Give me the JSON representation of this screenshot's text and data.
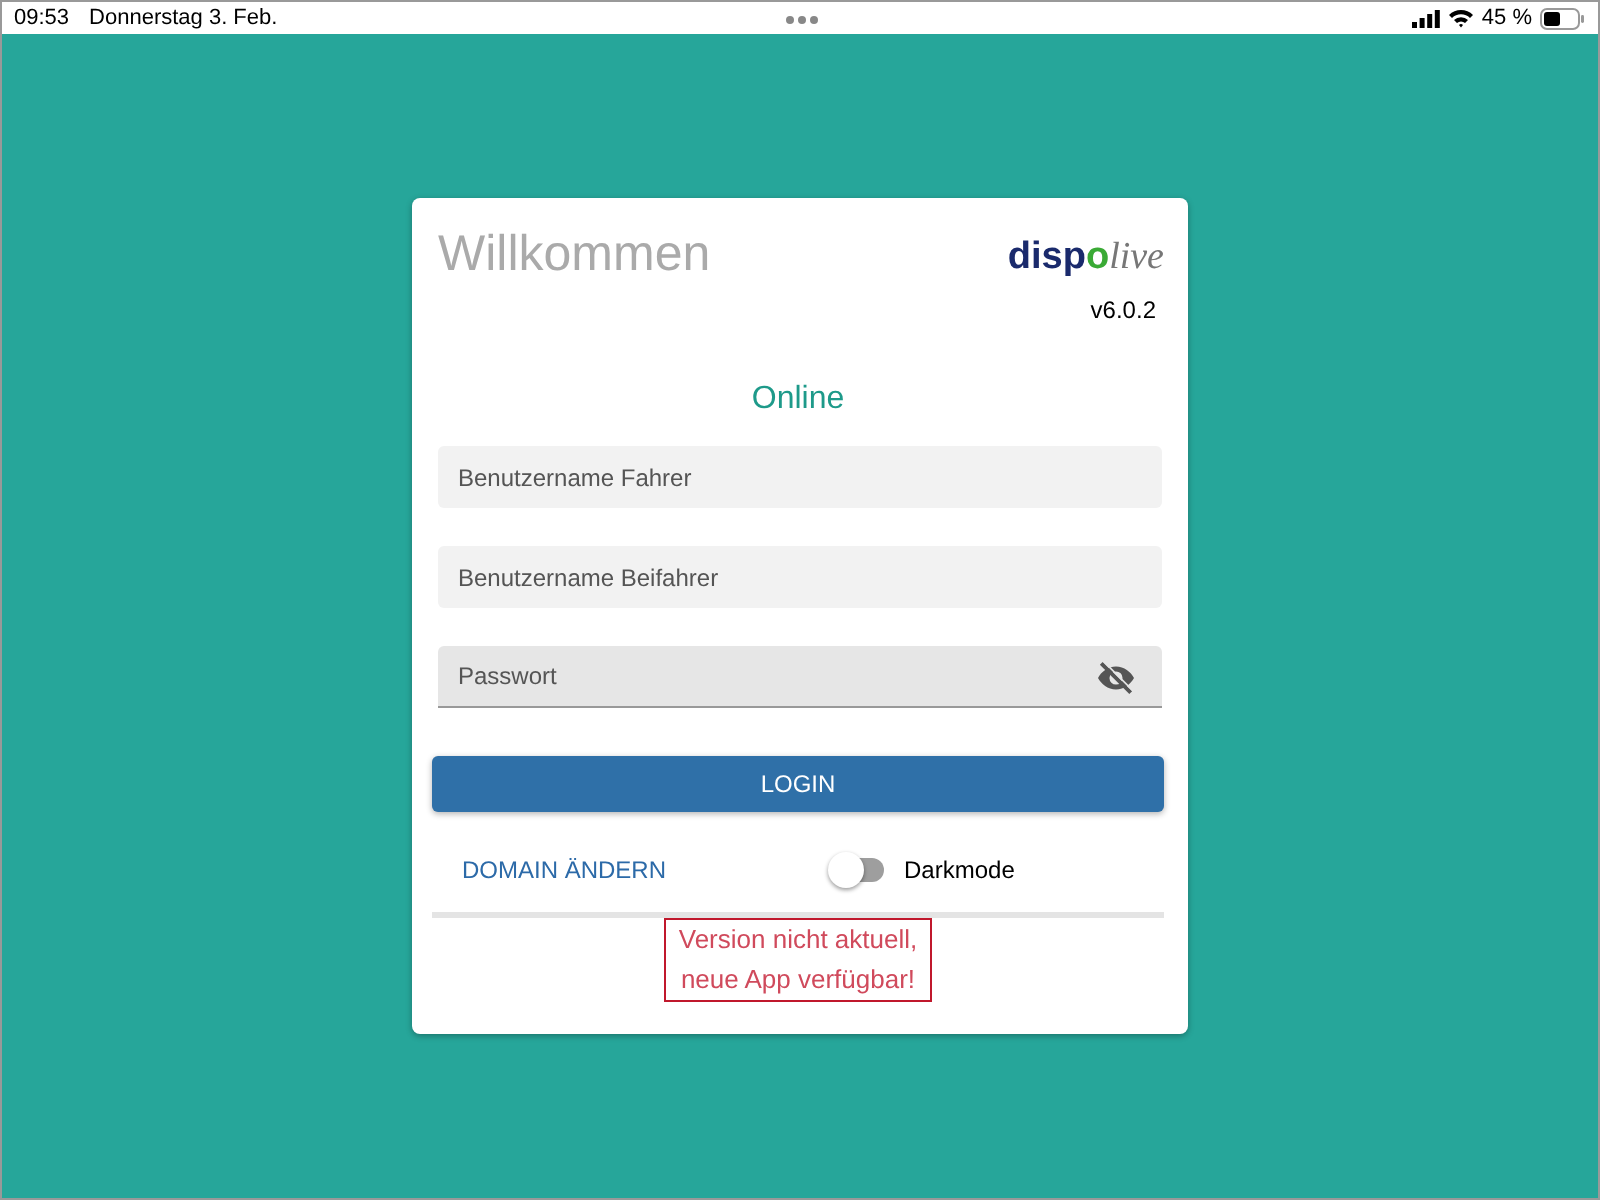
{
  "status_bar": {
    "time": "09:53",
    "date": "Donnerstag 3. Feb.",
    "battery": "45 %"
  },
  "login_card": {
    "title": "Willkommen",
    "logo": {
      "part_1": "disp",
      "part_2": "o",
      "part_3": "live"
    },
    "version": "v6.0.2",
    "connection_status": "Online",
    "fields": [
      {
        "placeholder": "Benutzername Fahrer",
        "kind": "text"
      },
      {
        "placeholder": "Benutzername Beifahrer",
        "kind": "text"
      },
      {
        "placeholder": "Passwort",
        "kind": "password"
      }
    ],
    "login_button": "LOGIN",
    "domain_link": "DOMAIN ÄNDERN",
    "darkmode": {
      "label": "Darkmode",
      "on": false
    },
    "warning": [
      "Version nicht aktuell,",
      "neue App verfügbar!"
    ]
  }
}
